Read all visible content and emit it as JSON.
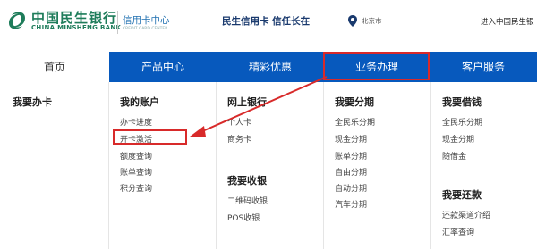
{
  "header": {
    "bank_name_cn": "中国民生银行",
    "bank_name_en": "CHINA MINSHENG BANK",
    "card_center_cn": "信用卡中心",
    "card_center_en": "CREDIT CARD CENTER",
    "slogan": "民生信用卡  信任长在",
    "city": "北京市",
    "enter_link": "进入中国民生银"
  },
  "nav": {
    "items": [
      "首页",
      "产品中心",
      "精彩优惠",
      "业务办理",
      "客户服务"
    ]
  },
  "menu": {
    "col1": {
      "title": "我要办卡"
    },
    "col2": {
      "title": "我的账户",
      "links": [
        "办卡进度",
        "开卡激活",
        "额度查询",
        "账单查询",
        "积分查询"
      ]
    },
    "col3": {
      "title": "网上银行",
      "links": [
        "个人卡",
        "商务卡"
      ],
      "title2": "我要收银",
      "links2": [
        "二维码收银",
        "POS收银"
      ]
    },
    "col4": {
      "title": "我要分期",
      "links": [
        "全民乐分期",
        "现金分期",
        "账单分期",
        "自由分期",
        "自动分期",
        "汽车分期"
      ]
    },
    "col5": {
      "title": "我要借钱",
      "links": [
        "全民乐分期",
        "现金分期",
        "随借金"
      ],
      "title2": "我要还款",
      "links2": [
        "还款渠道介绍",
        "汇率查询"
      ]
    }
  },
  "colors": {
    "brand_green": "#1e7c5a",
    "nav_blue": "#0759bd",
    "highlight_red": "#d82a2a"
  },
  "icons": [
    "minsheng-logo-icon",
    "location-pin-icon"
  ]
}
